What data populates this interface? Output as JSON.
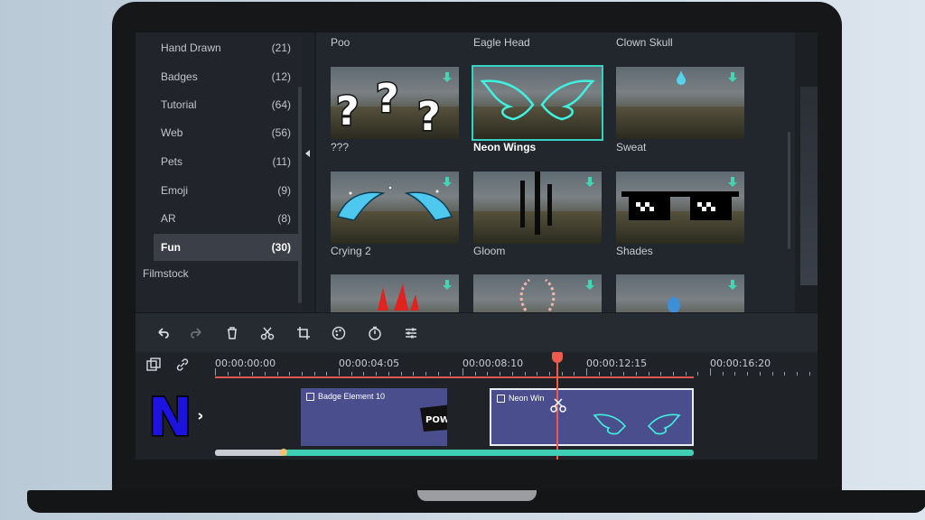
{
  "sidebar": {
    "items": [
      {
        "label": "Hand Drawn",
        "count": "(21)"
      },
      {
        "label": "Badges",
        "count": "(12)"
      },
      {
        "label": "Tutorial",
        "count": "(64)"
      },
      {
        "label": "Web",
        "count": "(56)"
      },
      {
        "label": "Pets",
        "count": "(11)"
      },
      {
        "label": "Emoji",
        "count": "(9)"
      },
      {
        "label": "AR",
        "count": "(8)"
      },
      {
        "label": "Fun",
        "count": "(30)"
      }
    ],
    "active_index": 7,
    "filmstock_label": "Filmstock"
  },
  "gallery": {
    "top_row_labels": [
      "Poo",
      "Eagle Head",
      "Clown Skull"
    ],
    "items": [
      {
        "label": "???",
        "selected": false
      },
      {
        "label": "Neon Wings",
        "selected": true
      },
      {
        "label": "Sweat",
        "selected": false
      },
      {
        "label": "Crying 2",
        "selected": false
      },
      {
        "label": "Gloom",
        "selected": false
      },
      {
        "label": "Shades",
        "selected": false
      }
    ]
  },
  "toolbar": {
    "icons": [
      "undo-icon",
      "redo-icon",
      "delete-icon",
      "cut-icon",
      "crop-icon",
      "color-icon",
      "speed-icon",
      "adjust-icon"
    ]
  },
  "timeline": {
    "timecodes": [
      "00:00:00:00",
      "00:00:04:05",
      "00:00:08:10",
      "00:00:12:15",
      "00:00:16:20"
    ],
    "clips": [
      {
        "label": "Badge Element 10",
        "badge_text": "POW"
      },
      {
        "label": "Neon Win",
        "selected": true
      }
    ],
    "logo_letter": "N"
  },
  "colors": {
    "accent_teal": "#37d1c0",
    "playhead_red": "#ef5a4c",
    "clip_blue": "#4a4e8c",
    "logo_blue": "#1c13e0"
  }
}
